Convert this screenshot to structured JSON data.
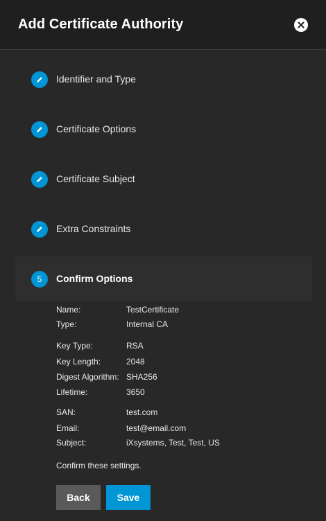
{
  "header": {
    "title": "Add Certificate Authority",
    "close_icon": "close-icon"
  },
  "steps": [
    {
      "label": "Identifier and Type",
      "icon": "pencil-icon"
    },
    {
      "label": "Certificate Options",
      "icon": "pencil-icon"
    },
    {
      "label": "Certificate Subject",
      "icon": "pencil-icon"
    },
    {
      "label": "Extra Constraints",
      "icon": "pencil-icon"
    },
    {
      "label": "Confirm Options",
      "number": "5"
    }
  ],
  "summary": [
    {
      "key": "Name:",
      "value": "TestCertificate"
    },
    {
      "key": "Type:",
      "value": "Internal CA"
    },
    {
      "key": "Key Type:",
      "value": "RSA"
    },
    {
      "key": "Key Length:",
      "value": "2048"
    },
    {
      "key": "Digest Algorithm:",
      "value": "SHA256"
    },
    {
      "key": "Lifetime:",
      "value": "3650"
    },
    {
      "key": "SAN:",
      "value": "test.com"
    },
    {
      "key": "Email:",
      "value": "test@email.com"
    },
    {
      "key": "Subject:",
      "value": "iXsystems, Test, Test, US"
    }
  ],
  "confirm_text": "Confirm these settings.",
  "buttons": {
    "back": "Back",
    "save": "Save"
  },
  "colors": {
    "accent": "#0095d5",
    "background": "#282828",
    "header": "#1f1f1f",
    "back_button": "#5a5a5a"
  }
}
